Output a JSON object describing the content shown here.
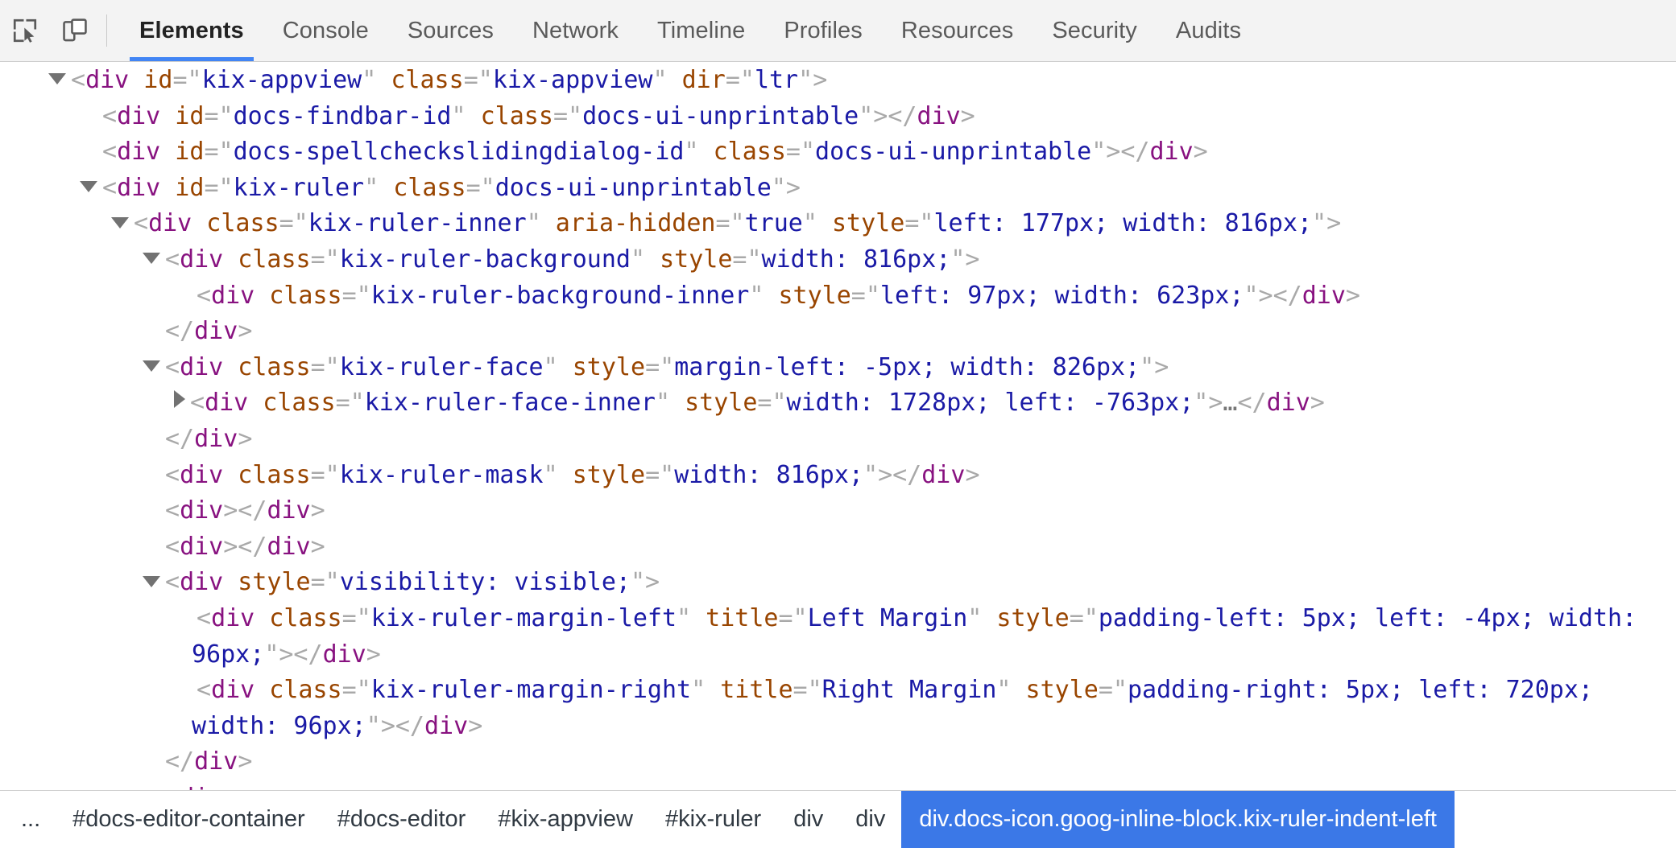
{
  "toolbar": {
    "inspect_icon": "inspect-cursor-icon",
    "device_icon": "device-toolbar-icon",
    "tabs": [
      {
        "label": "Elements",
        "active": true
      },
      {
        "label": "Console",
        "active": false
      },
      {
        "label": "Sources",
        "active": false
      },
      {
        "label": "Network",
        "active": false
      },
      {
        "label": "Timeline",
        "active": false
      },
      {
        "label": "Profiles",
        "active": false
      },
      {
        "label": "Resources",
        "active": false
      },
      {
        "label": "Security",
        "active": false
      },
      {
        "label": "Audits",
        "active": false
      }
    ]
  },
  "dom": {
    "lines": [
      {
        "indent": 2,
        "marker": "open",
        "segments": [
          {
            "c": "br",
            "t": "<"
          },
          {
            "c": "tg",
            "t": "div"
          },
          {
            "c": "at",
            "t": " id"
          },
          {
            "c": "eq",
            "t": "=\""
          },
          {
            "c": "va",
            "t": "kix-appview"
          },
          {
            "c": "eq",
            "t": "\""
          },
          {
            "c": "at",
            "t": " class"
          },
          {
            "c": "eq",
            "t": "=\""
          },
          {
            "c": "va",
            "t": "kix-appview"
          },
          {
            "c": "eq",
            "t": "\""
          },
          {
            "c": "at",
            "t": " dir"
          },
          {
            "c": "eq",
            "t": "=\""
          },
          {
            "c": "va",
            "t": "ltr"
          },
          {
            "c": "eq",
            "t": "\""
          },
          {
            "c": "br",
            "t": ">"
          }
        ]
      },
      {
        "indent": 3,
        "marker": "none",
        "segments": [
          {
            "c": "br",
            "t": "<"
          },
          {
            "c": "tg",
            "t": "div"
          },
          {
            "c": "at",
            "t": " id"
          },
          {
            "c": "eq",
            "t": "=\""
          },
          {
            "c": "va",
            "t": "docs-findbar-id"
          },
          {
            "c": "eq",
            "t": "\""
          },
          {
            "c": "at",
            "t": " class"
          },
          {
            "c": "eq",
            "t": "=\""
          },
          {
            "c": "va",
            "t": "docs-ui-unprintable"
          },
          {
            "c": "eq",
            "t": "\""
          },
          {
            "c": "br",
            "t": "></"
          },
          {
            "c": "tg",
            "t": "div"
          },
          {
            "c": "br",
            "t": ">"
          }
        ]
      },
      {
        "indent": 3,
        "marker": "none",
        "segments": [
          {
            "c": "br",
            "t": "<"
          },
          {
            "c": "tg",
            "t": "div"
          },
          {
            "c": "at",
            "t": " id"
          },
          {
            "c": "eq",
            "t": "=\""
          },
          {
            "c": "va",
            "t": "docs-spellcheckslidingdialog-id"
          },
          {
            "c": "eq",
            "t": "\""
          },
          {
            "c": "at",
            "t": " class"
          },
          {
            "c": "eq",
            "t": "=\""
          },
          {
            "c": "va",
            "t": "docs-ui-unprintable"
          },
          {
            "c": "eq",
            "t": "\""
          },
          {
            "c": "br",
            "t": "></"
          },
          {
            "c": "tg",
            "t": "div"
          },
          {
            "c": "br",
            "t": ">"
          }
        ]
      },
      {
        "indent": 3,
        "marker": "open",
        "segments": [
          {
            "c": "br",
            "t": "<"
          },
          {
            "c": "tg",
            "t": "div"
          },
          {
            "c": "at",
            "t": " id"
          },
          {
            "c": "eq",
            "t": "=\""
          },
          {
            "c": "va",
            "t": "kix-ruler"
          },
          {
            "c": "eq",
            "t": "\""
          },
          {
            "c": "at",
            "t": " class"
          },
          {
            "c": "eq",
            "t": "=\""
          },
          {
            "c": "va",
            "t": "docs-ui-unprintable"
          },
          {
            "c": "eq",
            "t": "\""
          },
          {
            "c": "br",
            "t": ">"
          }
        ]
      },
      {
        "indent": 4,
        "marker": "open",
        "segments": [
          {
            "c": "br",
            "t": "<"
          },
          {
            "c": "tg",
            "t": "div"
          },
          {
            "c": "at",
            "t": " class"
          },
          {
            "c": "eq",
            "t": "=\""
          },
          {
            "c": "va",
            "t": "kix-ruler-inner"
          },
          {
            "c": "eq",
            "t": "\""
          },
          {
            "c": "at",
            "t": " aria-hidden"
          },
          {
            "c": "eq",
            "t": "=\""
          },
          {
            "c": "va",
            "t": "true"
          },
          {
            "c": "eq",
            "t": "\""
          },
          {
            "c": "at",
            "t": " style"
          },
          {
            "c": "eq",
            "t": "=\""
          },
          {
            "c": "va",
            "t": "left: 177px; width: 816px;"
          },
          {
            "c": "eq",
            "t": "\""
          },
          {
            "c": "br",
            "t": ">"
          }
        ]
      },
      {
        "indent": 5,
        "marker": "open",
        "segments": [
          {
            "c": "br",
            "t": "<"
          },
          {
            "c": "tg",
            "t": "div"
          },
          {
            "c": "at",
            "t": " class"
          },
          {
            "c": "eq",
            "t": "=\""
          },
          {
            "c": "va",
            "t": "kix-ruler-background"
          },
          {
            "c": "eq",
            "t": "\""
          },
          {
            "c": "at",
            "t": " style"
          },
          {
            "c": "eq",
            "t": "=\""
          },
          {
            "c": "va",
            "t": "width: 816px;"
          },
          {
            "c": "eq",
            "t": "\""
          },
          {
            "c": "br",
            "t": ">"
          }
        ]
      },
      {
        "indent": 6,
        "marker": "none",
        "segments": [
          {
            "c": "br",
            "t": "<"
          },
          {
            "c": "tg",
            "t": "div"
          },
          {
            "c": "at",
            "t": " class"
          },
          {
            "c": "eq",
            "t": "=\""
          },
          {
            "c": "va",
            "t": "kix-ruler-background-inner"
          },
          {
            "c": "eq",
            "t": "\""
          },
          {
            "c": "at",
            "t": " style"
          },
          {
            "c": "eq",
            "t": "=\""
          },
          {
            "c": "va",
            "t": "left: 97px; width: 623px;"
          },
          {
            "c": "eq",
            "t": "\""
          },
          {
            "c": "br",
            "t": "></"
          },
          {
            "c": "tg",
            "t": "div"
          },
          {
            "c": "br",
            "t": ">"
          }
        ]
      },
      {
        "indent": 5,
        "marker": "none",
        "segments": [
          {
            "c": "br",
            "t": "</"
          },
          {
            "c": "tg",
            "t": "div"
          },
          {
            "c": "br",
            "t": ">"
          }
        ]
      },
      {
        "indent": 5,
        "marker": "open",
        "segments": [
          {
            "c": "br",
            "t": "<"
          },
          {
            "c": "tg",
            "t": "div"
          },
          {
            "c": "at",
            "t": " class"
          },
          {
            "c": "eq",
            "t": "=\""
          },
          {
            "c": "va",
            "t": "kix-ruler-face"
          },
          {
            "c": "eq",
            "t": "\""
          },
          {
            "c": "at",
            "t": " style"
          },
          {
            "c": "eq",
            "t": "=\""
          },
          {
            "c": "va",
            "t": "margin-left: -5px; width: 826px;"
          },
          {
            "c": "eq",
            "t": "\""
          },
          {
            "c": "br",
            "t": ">"
          }
        ]
      },
      {
        "indent": 6,
        "marker": "closed",
        "segments": [
          {
            "c": "br",
            "t": "<"
          },
          {
            "c": "tg",
            "t": "div"
          },
          {
            "c": "at",
            "t": " class"
          },
          {
            "c": "eq",
            "t": "=\""
          },
          {
            "c": "va",
            "t": "kix-ruler-face-inner"
          },
          {
            "c": "eq",
            "t": "\""
          },
          {
            "c": "at",
            "t": " style"
          },
          {
            "c": "eq",
            "t": "=\""
          },
          {
            "c": "va",
            "t": "width: 1728px; left: -763px;"
          },
          {
            "c": "eq",
            "t": "\""
          },
          {
            "c": "br",
            "t": ">"
          },
          {
            "c": "ell",
            "t": "…"
          },
          {
            "c": "br",
            "t": "</"
          },
          {
            "c": "tg",
            "t": "div"
          },
          {
            "c": "br",
            "t": ">"
          }
        ]
      },
      {
        "indent": 5,
        "marker": "none",
        "segments": [
          {
            "c": "br",
            "t": "</"
          },
          {
            "c": "tg",
            "t": "div"
          },
          {
            "c": "br",
            "t": ">"
          }
        ]
      },
      {
        "indent": 5,
        "marker": "none",
        "segments": [
          {
            "c": "br",
            "t": "<"
          },
          {
            "c": "tg",
            "t": "div"
          },
          {
            "c": "at",
            "t": " class"
          },
          {
            "c": "eq",
            "t": "=\""
          },
          {
            "c": "va",
            "t": "kix-ruler-mask"
          },
          {
            "c": "eq",
            "t": "\""
          },
          {
            "c": "at",
            "t": " style"
          },
          {
            "c": "eq",
            "t": "=\""
          },
          {
            "c": "va",
            "t": "width: 816px;"
          },
          {
            "c": "eq",
            "t": "\""
          },
          {
            "c": "br",
            "t": "></"
          },
          {
            "c": "tg",
            "t": "div"
          },
          {
            "c": "br",
            "t": ">"
          }
        ]
      },
      {
        "indent": 5,
        "marker": "none",
        "segments": [
          {
            "c": "br",
            "t": "<"
          },
          {
            "c": "tg",
            "t": "div"
          },
          {
            "c": "br",
            "t": "></"
          },
          {
            "c": "tg",
            "t": "div"
          },
          {
            "c": "br",
            "t": ">"
          }
        ]
      },
      {
        "indent": 5,
        "marker": "none",
        "segments": [
          {
            "c": "br",
            "t": "<"
          },
          {
            "c": "tg",
            "t": "div"
          },
          {
            "c": "br",
            "t": "></"
          },
          {
            "c": "tg",
            "t": "div"
          },
          {
            "c": "br",
            "t": ">"
          }
        ]
      },
      {
        "indent": 5,
        "marker": "open",
        "segments": [
          {
            "c": "br",
            "t": "<"
          },
          {
            "c": "tg",
            "t": "div"
          },
          {
            "c": "at",
            "t": " style"
          },
          {
            "c": "eq",
            "t": "=\""
          },
          {
            "c": "va",
            "t": "visibility: visible;"
          },
          {
            "c": "eq",
            "t": "\""
          },
          {
            "c": "br",
            "t": ">"
          }
        ]
      },
      {
        "indent": 6,
        "marker": "none",
        "segments": [
          {
            "c": "br",
            "t": "<"
          },
          {
            "c": "tg",
            "t": "div"
          },
          {
            "c": "at",
            "t": " class"
          },
          {
            "c": "eq",
            "t": "=\""
          },
          {
            "c": "va",
            "t": "kix-ruler-margin-left"
          },
          {
            "c": "eq",
            "t": "\""
          },
          {
            "c": "at",
            "t": " title"
          },
          {
            "c": "eq",
            "t": "=\""
          },
          {
            "c": "va",
            "t": "Left Margin"
          },
          {
            "c": "eq",
            "t": "\""
          },
          {
            "c": "at",
            "t": " style"
          },
          {
            "c": "eq",
            "t": "=\""
          },
          {
            "c": "va",
            "t": "padding-left: 5px; left: -4px; width: 96px;"
          },
          {
            "c": "eq",
            "t": "\""
          },
          {
            "c": "br",
            "t": "></"
          },
          {
            "c": "tg",
            "t": "div"
          },
          {
            "c": "br",
            "t": ">"
          }
        ]
      },
      {
        "indent": 6,
        "marker": "none",
        "segments": [
          {
            "c": "br",
            "t": "<"
          },
          {
            "c": "tg",
            "t": "div"
          },
          {
            "c": "at",
            "t": " class"
          },
          {
            "c": "eq",
            "t": "=\""
          },
          {
            "c": "va",
            "t": "kix-ruler-margin-right"
          },
          {
            "c": "eq",
            "t": "\""
          },
          {
            "c": "at",
            "t": " title"
          },
          {
            "c": "eq",
            "t": "=\""
          },
          {
            "c": "va",
            "t": "Right Margin"
          },
          {
            "c": "eq",
            "t": "\""
          },
          {
            "c": "at",
            "t": " style"
          },
          {
            "c": "eq",
            "t": "=\""
          },
          {
            "c": "va",
            "t": "padding-right: 5px; left: 720px; width: 96px;"
          },
          {
            "c": "eq",
            "t": "\""
          },
          {
            "c": "br",
            "t": "></"
          },
          {
            "c": "tg",
            "t": "div"
          },
          {
            "c": "br",
            "t": ">"
          }
        ]
      },
      {
        "indent": 5,
        "marker": "none",
        "segments": [
          {
            "c": "br",
            "t": "</"
          },
          {
            "c": "tg",
            "t": "div"
          },
          {
            "c": "br",
            "t": ">"
          }
        ]
      },
      {
        "indent": 5,
        "marker": "open",
        "segments": [
          {
            "c": "br",
            "t": "<"
          },
          {
            "c": "tg",
            "t": "div"
          },
          {
            "c": "br",
            "t": ">"
          }
        ]
      }
    ]
  },
  "breadcrumb": {
    "items": [
      {
        "label": "...",
        "selected": false
      },
      {
        "label": "#docs-editor-container",
        "selected": false
      },
      {
        "label": "#docs-editor",
        "selected": false
      },
      {
        "label": "#kix-appview",
        "selected": false
      },
      {
        "label": "#kix-ruler",
        "selected": false
      },
      {
        "label": "div",
        "selected": false
      },
      {
        "label": "div",
        "selected": false
      },
      {
        "label": "div.docs-icon.goog-inline-block.kix-ruler-indent-left",
        "selected": true
      }
    ]
  },
  "colors": {
    "accent": "#4285f4",
    "selection": "#3b78e7",
    "tag": "#881280",
    "attribute": "#994500",
    "value": "#1a1aa6",
    "punctuation": "#a9a9a9",
    "toolbar_bg": "#f3f3f3"
  }
}
